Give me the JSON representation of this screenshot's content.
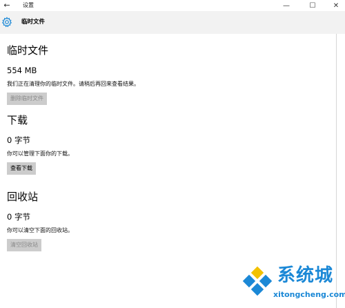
{
  "window": {
    "title": "设置",
    "back_glyph": "←",
    "minimize_glyph": "—",
    "maximize_glyph": "☐",
    "close_glyph": "✕"
  },
  "header": {
    "icon": "gear-icon",
    "title": "临时文件"
  },
  "sections": {
    "temp": {
      "title": "临时文件",
      "size": "554 MB",
      "description": "我们正在清理你的临时文件。请稍后再回来查看结果。",
      "button_label": "删除临时文件",
      "button_enabled": false
    },
    "downloads": {
      "title": "下载",
      "size": "0 字节",
      "description": "你可以管理下面你的下载。",
      "button_label": "查看下载",
      "button_enabled": true
    },
    "recycle": {
      "title": "回收站",
      "size": "0 字节",
      "description": "你可以清空下面的回收站。",
      "button_label": "清空回收站",
      "button_enabled": false
    }
  },
  "watermark": {
    "brand": "系统城",
    "domain": "xitongcheng.com"
  },
  "colors": {
    "header_bg": "#f2f2f2",
    "accent": "#1b88d6",
    "button_bg": "#cccccc",
    "disabled_text": "#8a8a8a"
  }
}
